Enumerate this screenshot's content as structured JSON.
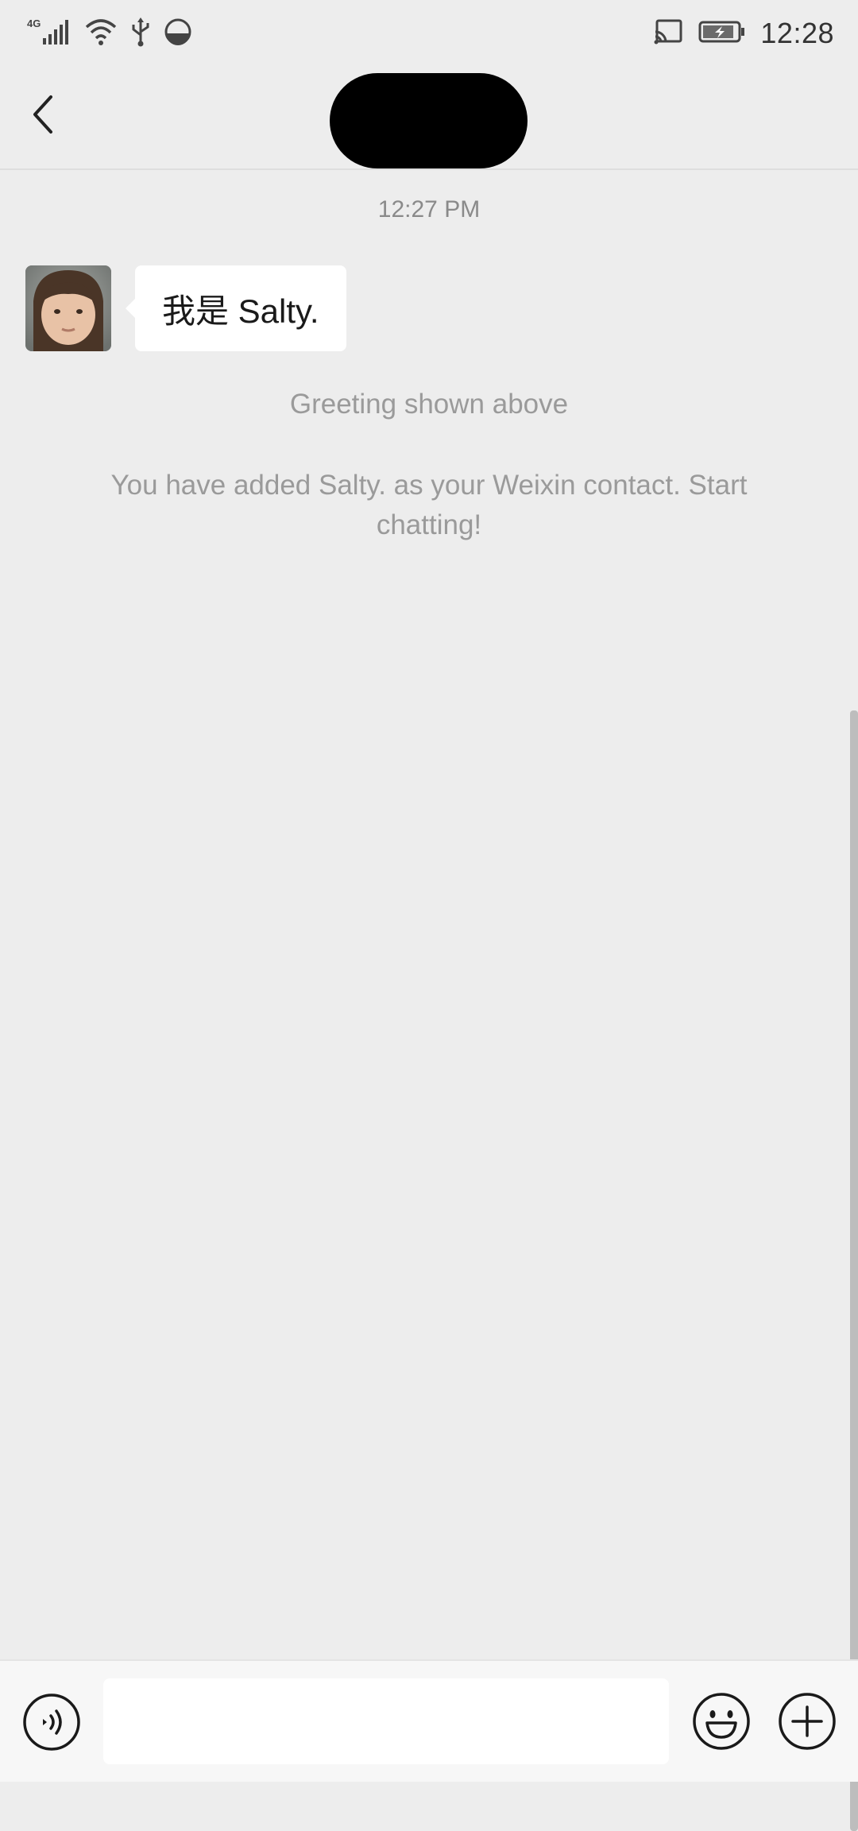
{
  "status_bar": {
    "network_label": "4G",
    "time": "12:28",
    "icons": [
      "signal-icon",
      "wifi-icon",
      "usb-icon",
      "data-saver-icon",
      "cast-icon",
      "battery-charging-icon"
    ]
  },
  "header": {
    "back_icon": "chevron-left-icon",
    "title_redacted": true
  },
  "chat": {
    "timestamp": "12:27 PM",
    "messages": [
      {
        "sender": "Salty.",
        "avatar": "contact-avatar",
        "text": "我是 Salty."
      }
    ],
    "system_notes": [
      "Greeting shown above",
      "You have added Salty. as your Weixin contact. Start chatting!"
    ]
  },
  "input_bar": {
    "voice_icon": "voice-input-icon",
    "message_value": "",
    "emoji_icon": "emoji-icon",
    "more_icon": "plus-circle-icon"
  },
  "colors": {
    "background": "#ededed",
    "bubble": "#ffffff",
    "system_text": "#9a9a9a",
    "input_bar": "#f7f7f7"
  }
}
